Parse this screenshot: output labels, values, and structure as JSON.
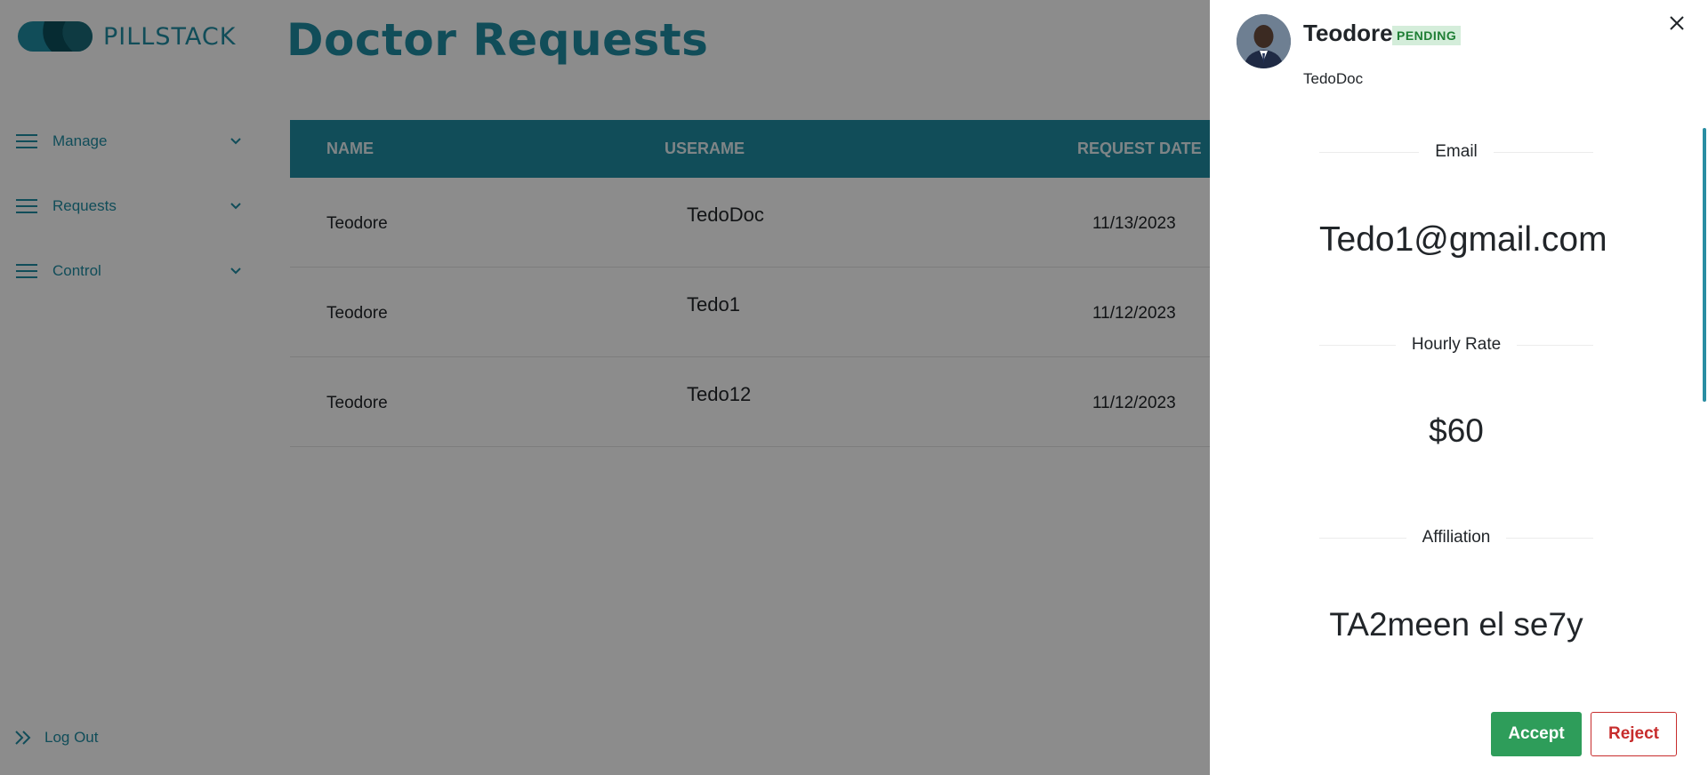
{
  "app": {
    "logo_text": "PILLSTACK"
  },
  "sidebar": {
    "items": [
      {
        "label": "Manage",
        "icon": "menu-icon"
      },
      {
        "label": "Requests",
        "icon": "menu-icon"
      },
      {
        "label": "Control",
        "icon": "menu-icon"
      }
    ],
    "logout_label": "Log Out"
  },
  "page": {
    "title": "Doctor Requests"
  },
  "table": {
    "headers": {
      "name": "NAME",
      "username": "USERAME",
      "request_date": "REQUEST DATE"
    },
    "rows": [
      {
        "name": "Teodore",
        "username": "TedoDoc",
        "date": "11/13/2023"
      },
      {
        "name": "Teodore",
        "username": "Tedo1",
        "date": "11/12/2023"
      },
      {
        "name": "Teodore",
        "username": "Tedo12",
        "date": "11/12/2023"
      }
    ]
  },
  "drawer": {
    "name": "Teodore",
    "status": "PENDING",
    "username": "TedoDoc",
    "email_label": "Email",
    "email": "Tedo1@gmail.com",
    "rate_label": "Hourly Rate",
    "rate": "$60",
    "affiliation_label": "Affiliation",
    "affiliation": "TA2meen el se7y",
    "accept_label": "Accept",
    "reject_label": "Reject"
  },
  "colors": {
    "brand": "#1f8ca3",
    "accept": "#2e9d5a",
    "reject": "#c72d2d",
    "pending_bg": "#d4edda"
  }
}
